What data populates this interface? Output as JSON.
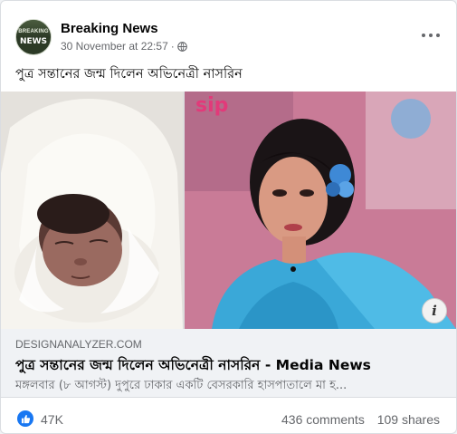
{
  "post": {
    "page_name": "Breaking News",
    "avatar_line1": "BREAKING",
    "avatar_line2": "NEWS",
    "timestamp": "30 November at 22:57",
    "separator": "·",
    "privacy_icon": "globe-icon",
    "more_icon": "more-options-icon",
    "text": "পুত্র সন্তানের জন্ম দিলেন অভিনেত্রী নাসরিন"
  },
  "media": {
    "left_image": "newborn-baby-photo",
    "right_image": "actress-photo",
    "info_label": "i"
  },
  "link": {
    "domain": "DESIGNANALYZER.COM",
    "title": "পুত্র সন্তানের জন্ম দিলেন অভিনেত্রী নাসরিন - Media News",
    "description": "মঙ্গলবার (৮ আগস্ট) দুপুরে ঢাকার একটি বেসরকারি হাসপাতালে মা হ..."
  },
  "stats": {
    "reaction_icon": "like-icon",
    "reactions": "47K",
    "comments": "436 comments",
    "shares": "109 shares"
  },
  "colors": {
    "accent": "#1877f2",
    "secondary_text": "#65676b",
    "link_box_bg": "#f0f2f5"
  }
}
